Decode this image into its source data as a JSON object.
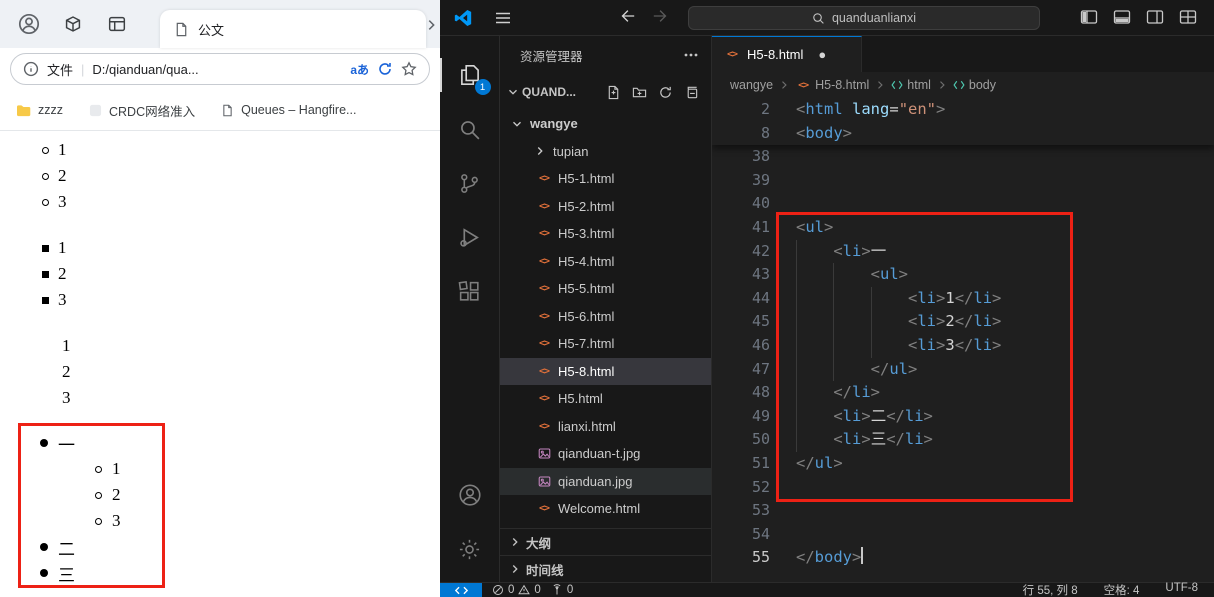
{
  "colors": {
    "annotation_red": "#ed2115",
    "vscode_accent": "#0078d4",
    "html_icon_orange": "#e0703a",
    "image_icon_purple": "#c586c0",
    "tag_blue": "#569cd6",
    "attr_blue": "#9cdcfe",
    "string_orange": "#ce9178"
  },
  "icons": {
    "html_file_glyph": "<>",
    "translate_glyph": "aあ",
    "modified_dot": "●"
  },
  "browser": {
    "tabstrip": {
      "tab_title": "公文"
    },
    "toolbar": {
      "scheme": "文件",
      "divider": "|",
      "url": "D:/qianduan/qua..."
    },
    "bookmarks": {
      "folder": "zzzz",
      "item2": "CRDC网络准入",
      "item3": "Queues – Hangfire..."
    },
    "page": {
      "circle_items": [
        "1",
        "2",
        "3"
      ],
      "square_items": [
        "1",
        "2",
        "3"
      ],
      "plain_items": [
        "1",
        "2",
        "3"
      ],
      "disc_first": "一",
      "nested_items": [
        "1",
        "2",
        "3"
      ],
      "disc_second": "二",
      "disc_third": "三"
    }
  },
  "vscode": {
    "search_value": "quanduanlianxi",
    "explorer_badge": "1",
    "sidebar": {
      "header": "资源管理器",
      "section": "QUAND...",
      "root_folder": "wangye",
      "subfolder": "tupian",
      "files": [
        {
          "name": "H5-1.html",
          "kind": "html"
        },
        {
          "name": "H5-2.html",
          "kind": "html"
        },
        {
          "name": "H5-3.html",
          "kind": "html"
        },
        {
          "name": "H5-4.html",
          "kind": "html"
        },
        {
          "name": "H5-5.html",
          "kind": "html"
        },
        {
          "name": "H5-6.html",
          "kind": "html"
        },
        {
          "name": "H5-7.html",
          "kind": "html"
        },
        {
          "name": "H5-8.html",
          "kind": "html",
          "selected": true
        },
        {
          "name": "H5.html",
          "kind": "html"
        },
        {
          "name": "lianxi.html",
          "kind": "html"
        },
        {
          "name": "qianduan-t.jpg",
          "kind": "img"
        },
        {
          "name": "qianduan.jpg",
          "kind": "img",
          "hover": true
        },
        {
          "name": "Welcome.html",
          "kind": "html"
        }
      ],
      "outline": "大纲",
      "timeline": "时间线"
    },
    "editor": {
      "tab_title": "H5-8.html",
      "breadcrumbs": [
        "wangye",
        "H5-8.html",
        "html",
        "body"
      ],
      "sticky_lines": [
        {
          "n": "2",
          "tokens": [
            [
              "p",
              "<"
            ],
            [
              "t",
              "html"
            ],
            [
              "w",
              " "
            ],
            [
              "a",
              "lang"
            ],
            [
              "o",
              "="
            ],
            [
              "s",
              "\"en\""
            ],
            [
              "p",
              ">"
            ]
          ]
        },
        {
          "n": "8",
          "tokens": [
            [
              "p",
              "<"
            ],
            [
              "t",
              "body"
            ],
            [
              "p",
              ">"
            ]
          ]
        }
      ],
      "lines": [
        {
          "n": "38",
          "tokens": []
        },
        {
          "n": "39",
          "tokens": []
        },
        {
          "n": "40",
          "tokens": []
        },
        {
          "n": "41",
          "tokens": [
            [
              "p",
              "<"
            ],
            [
              "t",
              "ul"
            ],
            [
              "p",
              ">"
            ]
          ]
        },
        {
          "n": "42",
          "tokens": [
            [
              "w",
              "    "
            ],
            [
              "p",
              "<"
            ],
            [
              "t",
              "li"
            ],
            [
              "p",
              ">"
            ],
            [
              "x",
              "一"
            ]
          ]
        },
        {
          "n": "43",
          "tokens": [
            [
              "w",
              "        "
            ],
            [
              "p",
              "<"
            ],
            [
              "t",
              "ul"
            ],
            [
              "p",
              ">"
            ]
          ]
        },
        {
          "n": "44",
          "tokens": [
            [
              "w",
              "            "
            ],
            [
              "p",
              "<"
            ],
            [
              "t",
              "li"
            ],
            [
              "p",
              ">"
            ],
            [
              "x",
              "1"
            ],
            [
              "p",
              "</"
            ],
            [
              "t",
              "li"
            ],
            [
              "p",
              ">"
            ]
          ]
        },
        {
          "n": "45",
          "tokens": [
            [
              "w",
              "            "
            ],
            [
              "p",
              "<"
            ],
            [
              "t",
              "li"
            ],
            [
              "p",
              ">"
            ],
            [
              "x",
              "2"
            ],
            [
              "p",
              "</"
            ],
            [
              "t",
              "li"
            ],
            [
              "p",
              ">"
            ]
          ]
        },
        {
          "n": "46",
          "tokens": [
            [
              "w",
              "            "
            ],
            [
              "p",
              "<"
            ],
            [
              "t",
              "li"
            ],
            [
              "p",
              ">"
            ],
            [
              "x",
              "3"
            ],
            [
              "p",
              "</"
            ],
            [
              "t",
              "li"
            ],
            [
              "p",
              ">"
            ]
          ]
        },
        {
          "n": "47",
          "tokens": [
            [
              "w",
              "        "
            ],
            [
              "p",
              "</"
            ],
            [
              "t",
              "ul"
            ],
            [
              "p",
              ">"
            ]
          ]
        },
        {
          "n": "48",
          "tokens": [
            [
              "w",
              "    "
            ],
            [
              "p",
              "</"
            ],
            [
              "t",
              "li"
            ],
            [
              "p",
              ">"
            ]
          ]
        },
        {
          "n": "49",
          "tokens": [
            [
              "w",
              "    "
            ],
            [
              "p",
              "<"
            ],
            [
              "t",
              "li"
            ],
            [
              "p",
              ">"
            ],
            [
              "x",
              "二"
            ],
            [
              "p",
              "</"
            ],
            [
              "t",
              "li"
            ],
            [
              "p",
              ">"
            ]
          ]
        },
        {
          "n": "50",
          "tokens": [
            [
              "w",
              "    "
            ],
            [
              "p",
              "<"
            ],
            [
              "t",
              "li"
            ],
            [
              "p",
              ">"
            ],
            [
              "x",
              "三"
            ],
            [
              "p",
              "</"
            ],
            [
              "t",
              "li"
            ],
            [
              "p",
              ">"
            ]
          ]
        },
        {
          "n": "51",
          "tokens": [
            [
              "p",
              "</"
            ],
            [
              "t",
              "ul"
            ],
            [
              "p",
              ">"
            ]
          ]
        },
        {
          "n": "52",
          "tokens": []
        },
        {
          "n": "53",
          "tokens": []
        },
        {
          "n": "54",
          "tokens": []
        },
        {
          "n": "55",
          "tokens": [
            [
              "p",
              "</"
            ],
            [
              "t",
              "body"
            ],
            [
              "p",
              ">"
            ]
          ],
          "cursor": true
        }
      ]
    },
    "status": {
      "problems_errors": "0",
      "problems_warnings": "0",
      "ports": "0",
      "cursor_position": "行 55, 列 8",
      "indentation": "空格: 4",
      "encoding": "UTF-8"
    }
  }
}
